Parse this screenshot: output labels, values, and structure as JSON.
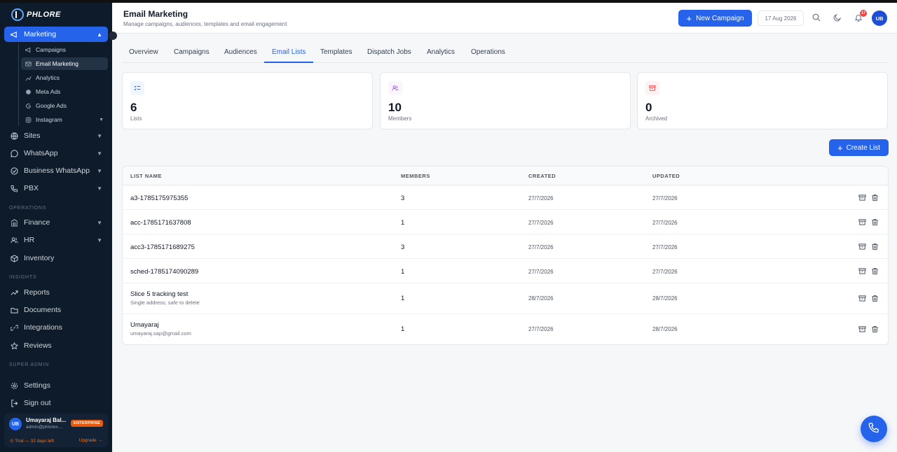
{
  "sidebar": {
    "logo": "PHLORE",
    "marketing": {
      "label": "Marketing",
      "children": [
        {
          "label": "Campaigns"
        },
        {
          "label": "Email Marketing"
        },
        {
          "label": "Analytics"
        },
        {
          "label": "Meta Ads"
        },
        {
          "label": "Google Ads"
        },
        {
          "label": "Instagram"
        }
      ]
    },
    "items": [
      {
        "label": "Sites"
      },
      {
        "label": "WhatsApp"
      },
      {
        "label": "Business WhatsApp"
      },
      {
        "label": "PBX"
      }
    ],
    "sections": {
      "operations": "OPERATIONS",
      "insights": "INSIGHTS",
      "super_admin": "SUPER ADMIN"
    },
    "operations_items": [
      {
        "label": "Finance"
      },
      {
        "label": "HR"
      },
      {
        "label": "Inventory"
      }
    ],
    "insights_items": [
      {
        "label": "Reports"
      },
      {
        "label": "Documents"
      },
      {
        "label": "Integrations"
      },
      {
        "label": "Reviews"
      }
    ],
    "admin_items": [
      {
        "label": "Settings"
      },
      {
        "label": "Sign out"
      }
    ],
    "user": {
      "initials": "UB",
      "name": "Umayaraj Bal...",
      "email": "admin@phlorex....",
      "plan": "ENTERPRISE",
      "trial": "⊙ Trial — 32 days left",
      "upgrade": "Upgrade →"
    }
  },
  "header": {
    "title": "Email Marketing",
    "subtitle": "Manage campaigns, audiences, templates and email engagement",
    "new_campaign": "New Campaign",
    "date": "17 Aug 2026",
    "notifications": "17",
    "avatar": "UB"
  },
  "tabs": [
    {
      "label": "Overview"
    },
    {
      "label": "Campaigns"
    },
    {
      "label": "Audiences"
    },
    {
      "label": "Email Lists"
    },
    {
      "label": "Templates"
    },
    {
      "label": "Dispatch Jobs"
    },
    {
      "label": "Analytics"
    },
    {
      "label": "Operations"
    }
  ],
  "stats": [
    {
      "value": "6",
      "label": "Lists"
    },
    {
      "value": "10",
      "label": "Members"
    },
    {
      "value": "0",
      "label": "Archived"
    }
  ],
  "create_list": "Create List",
  "table": {
    "headers": {
      "name": "LIST NAME",
      "members": "MEMBERS",
      "created": "CREATED",
      "updated": "UPDATED"
    },
    "rows": [
      {
        "name": "a3-1785175975355",
        "desc": "",
        "members": "3",
        "created": "27/7/2026",
        "updated": "27/7/2026"
      },
      {
        "name": "acc-1785171637808",
        "desc": "",
        "members": "1",
        "created": "27/7/2026",
        "updated": "27/7/2026"
      },
      {
        "name": "acc3-1785171689275",
        "desc": "",
        "members": "3",
        "created": "27/7/2026",
        "updated": "27/7/2026"
      },
      {
        "name": "sched-1785174090289",
        "desc": "",
        "members": "1",
        "created": "27/7/2026",
        "updated": "27/7/2026"
      },
      {
        "name": "Slice 5 tracking test",
        "desc": "Single address; safe to delete",
        "members": "1",
        "created": "28/7/2026",
        "updated": "28/7/2026"
      },
      {
        "name": "Umayaraj",
        "desc": "umayaraj.sap@gmail.com",
        "members": "1",
        "created": "27/7/2026",
        "updated": "28/7/2026"
      }
    ]
  },
  "colors": {
    "accent": "#2563eb",
    "sidebar_bg": "#0d1b2a",
    "badge_orange": "#ea580c"
  }
}
